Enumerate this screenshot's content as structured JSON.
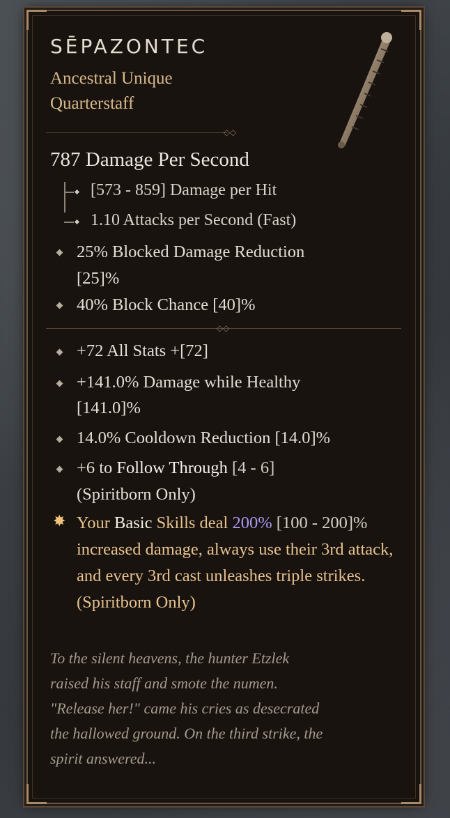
{
  "item": {
    "name": "SĒPAZONTEC",
    "rarity": "Ancestral Unique",
    "type": "Quarterstaff",
    "icon": "quarterstaff-icon"
  },
  "stats": {
    "dps": "787 Damage Per Second",
    "damage_per_hit": "[573 - 859] Damage per Hit",
    "attacks_per_second": "1.10 Attacks per Second (Fast)",
    "blocked_damage_line1": "25% Blocked Damage Reduction",
    "blocked_damage_line2": "[25]%",
    "block_chance": "40% Block Chance [40]%"
  },
  "affixes": {
    "all_stats": "+72 All Stats +[72]",
    "damage_healthy_line1": "+141.0% Damage while Healthy",
    "damage_healthy_line2": "[141.0]%",
    "cooldown": "14.0% Cooldown Reduction [14.0]%",
    "follow_prefix": "+6 to ",
    "follow_skill": "Follow Through",
    "follow_range": " [4 - 6]",
    "follow_line2": "(Spiritborn Only)"
  },
  "unique_power": {
    "p1": "Your ",
    "p2": "Basic",
    "p3": " Skills deal ",
    "p4": "200%",
    "p5": " [100 -",
    "p6": "200]%",
    "p7": " increased damage, always use their 3rd attack, and every 3rd cast unleashes triple strikes. (Spiritborn Only)"
  },
  "flavor": {
    "l1": "To the silent heavens, the hunter Etzlek",
    "l2": "raised his staff and smote the numen.",
    "l3": "\"Release her!\" came his cries as desecrated",
    "l4": "the hallowed ground. On the third strike, the",
    "l5": "spirit answered..."
  },
  "colors": {
    "unique_gold": "#e7c28f",
    "value_purple": "#a99af3",
    "panel_bg": "#18130f"
  }
}
